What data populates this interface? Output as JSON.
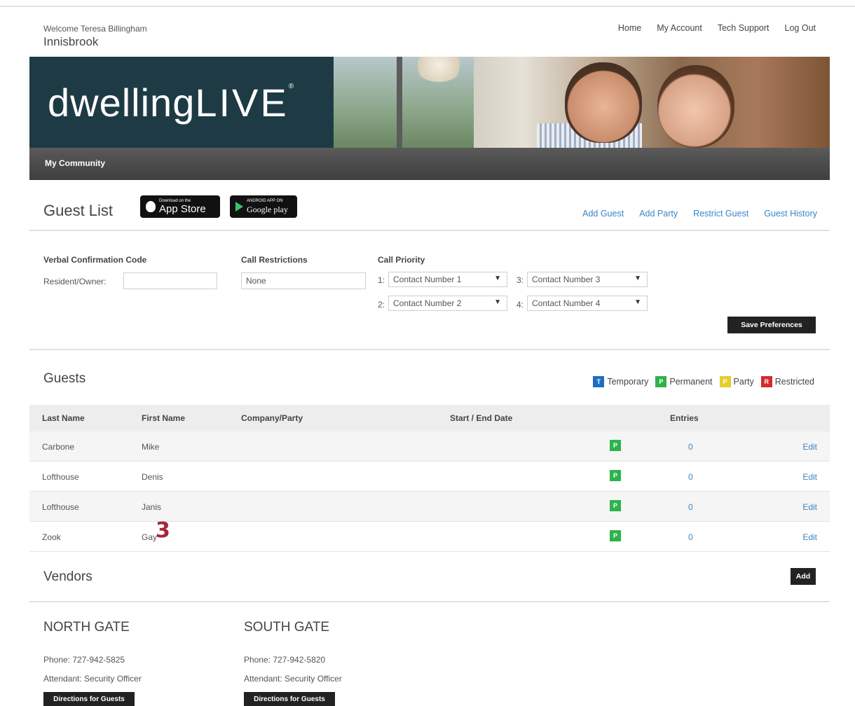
{
  "header": {
    "welcome": "Welcome Teresa Billingham",
    "community": "Innisbrook",
    "nav": [
      "Home",
      "My Account",
      "Tech Support",
      "Log Out"
    ]
  },
  "banner": {
    "logo_part1": "dwelling",
    "logo_part2": "LIVE",
    "logo_mark": "®"
  },
  "menubar": {
    "item": "My Community"
  },
  "guest_list": {
    "title": "Guest List",
    "app_store": {
      "small": "Download on the",
      "big": "App Store"
    },
    "google_play": {
      "small": "ANDROID APP ON",
      "big": "Google play"
    },
    "links": [
      "Add Guest",
      "Add Party",
      "Restrict Guest",
      "Guest History"
    ]
  },
  "preferences": {
    "vcc_label": "Verbal Confirmation Code",
    "resident_label": "Resident/Owner:",
    "resident_value": "",
    "restrictions_label": "Call Restrictions",
    "restrictions_value": "None",
    "priority_label": "Call Priority",
    "priorities": [
      {
        "num": "1:",
        "value": "Contact Number 1"
      },
      {
        "num": "3:",
        "value": "Contact Number 3"
      },
      {
        "num": "2:",
        "value": "Contact Number 2"
      },
      {
        "num": "4:",
        "value": "Contact Number 4"
      }
    ],
    "save_label": "Save Preferences"
  },
  "guests": {
    "title": "Guests",
    "legend": [
      {
        "code": "T",
        "label": "Temporary",
        "color": "#1f6fc1"
      },
      {
        "code": "P",
        "label": "Permanent",
        "color": "#2db34a"
      },
      {
        "code": "P",
        "label": "Party",
        "color": "#e3cf2a"
      },
      {
        "code": "R",
        "label": "Restricted",
        "color": "#d52b2b"
      }
    ],
    "columns": [
      "Last Name",
      "First Name",
      "Company/Party",
      "Start / End Date",
      "Entries"
    ],
    "rows": [
      {
        "last": "Carbone",
        "first": "Mike",
        "type": "P",
        "entries": "0",
        "edit": "Edit"
      },
      {
        "last": "Lofthouse",
        "first": "Denis",
        "type": "P",
        "entries": "0",
        "edit": "Edit"
      },
      {
        "last": "Lofthouse",
        "first": "Janis",
        "type": "P",
        "entries": "0",
        "edit": "Edit"
      },
      {
        "last": "Zook",
        "first": "Gay",
        "type": "P",
        "entries": "0",
        "edit": "Edit"
      }
    ],
    "annotation": "3"
  },
  "vendors": {
    "title": "Vendors",
    "add_label": "Add"
  },
  "gates": [
    {
      "name": "NORTH GATE",
      "phone": "Phone: 727-942-5825",
      "attendant": "Attendant: Security Officer",
      "button": "Directions for Guests"
    },
    {
      "name": "SOUTH GATE",
      "phone": "Phone: 727-942-5820",
      "attendant": "Attendant: Security Officer",
      "button": "Directions for Guests"
    }
  ]
}
